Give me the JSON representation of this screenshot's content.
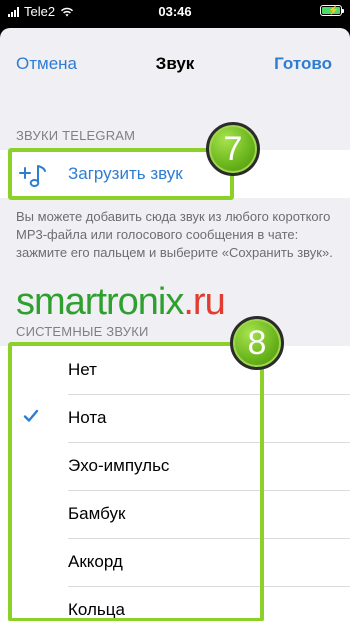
{
  "status_bar": {
    "carrier": "Tele2",
    "time": "03:46",
    "battery_charging": true
  },
  "nav": {
    "cancel_label": "Отмена",
    "title": "Звук",
    "done_label": "Готово"
  },
  "telegram_section": {
    "header": "ЗВУКИ TELEGRAM",
    "upload_label": "Загрузить звук",
    "upload_icon": "music-note-plus-icon",
    "footer": "Вы можете добавить сюда звук из любого короткого MP3-файла или голосового сообщения в чате: зажмите его пальцем и выберите «Сохранить звук»."
  },
  "watermark": {
    "text_main": "smartronix",
    "text_tld": ".ru"
  },
  "system_section": {
    "header": "СИСТЕМНЫЕ ЗВУКИ",
    "items": [
      {
        "label": "Нет",
        "selected": false
      },
      {
        "label": "Нота",
        "selected": true
      },
      {
        "label": "Эхо-импульс",
        "selected": false
      },
      {
        "label": "Бамбук",
        "selected": false
      },
      {
        "label": "Аккорд",
        "selected": false
      },
      {
        "label": "Кольца",
        "selected": false
      }
    ]
  },
  "annotations": {
    "badge_upload": "7",
    "badge_system": "8",
    "highlight_color": "#8bd12a"
  },
  "colors": {
    "accent": "#2f7dd1",
    "background": "#efeff4"
  }
}
